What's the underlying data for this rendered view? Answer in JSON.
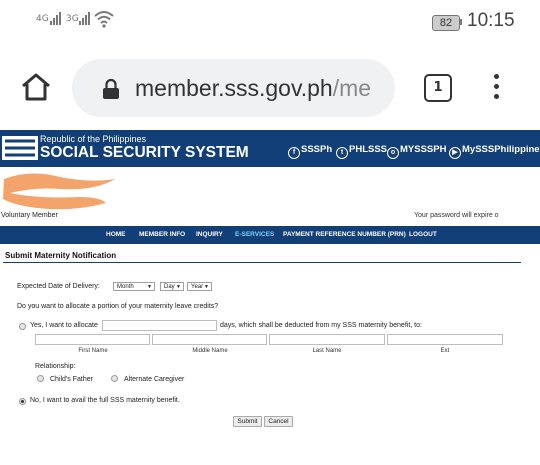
{
  "status_bar": {
    "signal_1": "4G",
    "signal_2": "3G",
    "battery": "82",
    "time": "10:15"
  },
  "browser": {
    "url_host": "member.sss.gov.ph",
    "url_path": "/me",
    "tab_count": "1"
  },
  "sss": {
    "republic": "Republic of the Philippines",
    "title": "SOCIAL SECURITY SYSTEM",
    "social": [
      {
        "label": "SSSPh"
      },
      {
        "label": "PHLSSS"
      },
      {
        "label": "MYSSSPH"
      },
      {
        "label": "MySSSPhilippines"
      }
    ]
  },
  "member": {
    "type": "Voluntary Member",
    "password_notice": "Your password will expire o"
  },
  "nav": [
    {
      "label": "HOME"
    },
    {
      "label": "MEMBER INFO"
    },
    {
      "label": "INQUIRY"
    },
    {
      "label": "E-SERVICES"
    },
    {
      "label": "PAYMENT REFERENCE NUMBER (PRN)"
    },
    {
      "label": "LOGOUT"
    }
  ],
  "form": {
    "title": "Submit Maternity Notification",
    "delivery_label": "Expected Date of Delivery:",
    "month": "Month",
    "day": "Day",
    "year": "Year",
    "question": "Do you want to allocate a portion of your maternity leave credits?",
    "yes_prefix": "Yes, I want to allocate",
    "yes_suffix": "days, which shall be deducted from my SSS maternity benefit, to:",
    "name_labels": [
      "First Name",
      "Middle Name",
      "Last Name",
      "Ext"
    ],
    "relationship_label": "Relationship:",
    "relationship_options": [
      "Child's Father",
      "Alternate Caregiver"
    ],
    "no_option": "No, I want to avail the full SSS maternity benefit.",
    "submit": "Submit",
    "cancel": "Cancel"
  },
  "colors": {
    "brand_blue": "#123f78",
    "active_nav": "#7fd0ff",
    "redaction": "#f39a5a"
  }
}
